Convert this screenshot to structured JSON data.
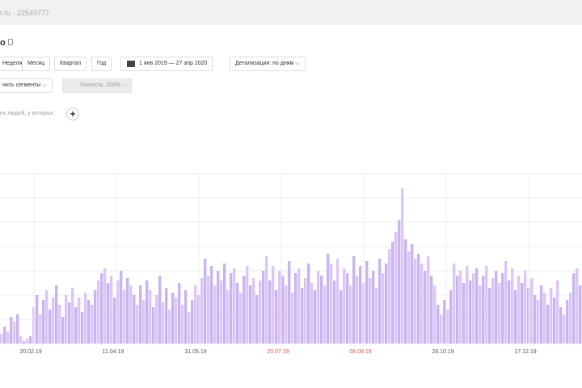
{
  "header": {
    "site": "r.ru · 22549777"
  },
  "report": {
    "title": "о"
  },
  "toolbar": {
    "week": "Неделя",
    "month": "Месяц",
    "quarter": "Квартал",
    "year": "Год",
    "date_range": "1 янв 2019 — 27 апр 2020",
    "detail": "Детализация: по дням"
  },
  "segments": {
    "label": "нить сегменты",
    "accuracy": "Точность: 100%"
  },
  "filter": {
    "hint": "ех людей, у которых",
    "add": "+"
  },
  "chart_data": {
    "type": "bar",
    "title": "",
    "xlabel": "",
    "ylabel": "",
    "ylim": [
      0,
      7
    ],
    "grid": true,
    "x_ticks": [
      {
        "label": "20.02.19",
        "weekend": false
      },
      {
        "label": "11.04.19",
        "weekend": false
      },
      {
        "label": "31.05.19",
        "weekend": false
      },
      {
        "label": "20.07.19",
        "weekend": true
      },
      {
        "label": "08.09.19",
        "weekend": true
      },
      {
        "label": "28.10.19",
        "weekend": false
      },
      {
        "label": "17.12.19",
        "weekend": false
      }
    ],
    "colors": [
      "#dcc6f6",
      "#c8b5ef"
    ],
    "values": [
      0.4,
      0.7,
      0.5,
      1.1,
      0.9,
      1.2,
      0.3,
      0.1,
      0.2,
      0.3,
      1.5,
      2,
      1.2,
      1.8,
      2.2,
      1.4,
      1.9,
      2.4,
      1.6,
      1.1,
      2,
      1.7,
      2.3,
      1.5,
      1.9,
      1.3,
      2.1,
      1.8,
      1.6,
      2.2,
      2.6,
      2.9,
      3.1,
      2.5,
      2.8,
      1.9,
      2.6,
      3,
      2.2,
      2.7,
      2.4,
      2,
      1.6,
      2.4,
      1.8,
      2.6,
      2.2,
      1.5,
      2,
      2.8,
      1.7,
      2.3,
      1.4,
      2.1,
      1.9,
      2.5,
      1.6,
      2.2,
      1.3,
      1.8,
      2.4,
      2,
      2.7,
      3.5,
      2.8,
      3.2,
      2.4,
      3,
      2.6,
      3.3,
      2.2,
      2.9,
      3.1,
      2.5,
      2.1,
      2.8,
      3.2,
      2.4,
      2.7,
      2,
      2.6,
      3,
      3.6,
      2.6,
      3.2,
      2.2,
      3,
      2.8,
      2.4,
      3.4,
      2.1,
      2.9,
      3.1,
      2.3,
      2.7,
      3.3,
      2.5,
      2.2,
      3,
      2.8,
      2.4,
      3.7,
      3.3,
      2.6,
      3.5,
      2.2,
      3.1,
      2.9,
      2.4,
      3.6,
      2.8,
      3.2,
      2.5,
      3.4,
      2.7,
      3,
      2.3,
      3.5,
      2.9,
      3.3,
      3.9,
      4.2,
      4.6,
      5.1,
      6.4,
      4.3,
      3.8,
      4.1,
      3.5,
      3.7,
      3.3,
      3,
      3.6,
      2.8,
      2.4,
      1.6,
      1.2,
      1.8,
      1.4,
      2.2,
      3.3,
      2.8,
      3,
      2.5,
      3.2,
      2.6,
      2.9,
      3.1,
      2.4,
      2.8,
      3.2,
      2.3,
      2.7,
      3,
      2.5,
      2.9,
      3.4,
      2.6,
      3.1,
      2.2,
      2.8,
      2.5,
      3,
      2.3,
      2.7,
      2,
      1.8,
      2.4,
      2.1,
      1.6,
      2.3,
      1.9,
      2.6,
      1.5,
      1.2,
      1.8,
      2.1,
      2.9,
      3.1,
      2.4
    ]
  }
}
